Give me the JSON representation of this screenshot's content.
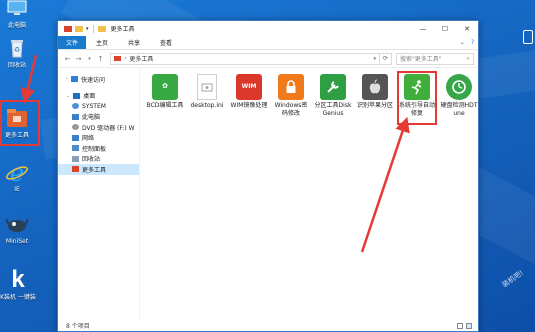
{
  "desktop": {
    "icons": [
      {
        "label": "此电脑",
        "icon": "computer-icon"
      },
      {
        "label": "回收站",
        "icon": "recycle-bin-icon"
      },
      {
        "label": "更多工具",
        "icon": "toolbox-folder-icon"
      },
      {
        "label": "IE",
        "icon": "ie-icon"
      },
      {
        "label": "MiniSet",
        "icon": "miniset-icon"
      },
      {
        "label": "K装机 一键装",
        "icon": "k-logo-icon"
      }
    ],
    "watermark": "装机吧!",
    "right_edge_icon": "network-icon"
  },
  "window": {
    "title": "更多工具",
    "ribbon_tabs": [
      "文件",
      "主页",
      "共享",
      "查看"
    ],
    "address": [
      "更多工具"
    ],
    "search_placeholder": "搜索\"更多工具\"",
    "sidebar": [
      {
        "label": "快速访问",
        "level": 0,
        "color": "#2f7fd6"
      },
      {
        "label": "桌面",
        "level": 0,
        "color": "#1e6fc2"
      },
      {
        "label": "SYSTEM",
        "level": 1,
        "color": "#4a90d9"
      },
      {
        "label": "此电脑",
        "level": 1,
        "color": "#3b7fc4"
      },
      {
        "label": "DVD 驱动器 (F:) W",
        "level": 1,
        "color": "#777777"
      },
      {
        "label": "网络",
        "level": 1,
        "color": "#3b7fc4"
      },
      {
        "label": "控制面板",
        "level": 1,
        "color": "#4f8bc9"
      },
      {
        "label": "回收站",
        "level": 1,
        "color": "#8aa0b8"
      },
      {
        "label": "更多工具",
        "level": 1,
        "color": "#d9442a",
        "selected": true
      }
    ],
    "files": [
      {
        "name": "BCD编辑工具",
        "color": "#38a842",
        "glyph": "✿",
        "icon": "bcd-editor-icon"
      },
      {
        "name": "desktop.ini",
        "color": "#eeeeee",
        "glyph": "",
        "icon": "ini-file-icon"
      },
      {
        "name": "WIM镜像处理",
        "color": "#d9382b",
        "glyph": "WIM",
        "icon": "wim-icon"
      },
      {
        "name": "Windows密码修改",
        "color": "#f07a1a",
        "glyph": "🔒",
        "icon": "password-lock-icon"
      },
      {
        "name": "分区工具DiskGenius",
        "color": "#2ea043",
        "glyph": "🔧",
        "icon": "diskgenius-icon"
      },
      {
        "name": "识别苹果分区",
        "color": "#555555",
        "glyph": "",
        "icon": "apple-icon"
      },
      {
        "name": "系统引导自动修复",
        "color": "#3fae3a",
        "glyph": "🏃",
        "icon": "boot-repair-icon",
        "highlighted": true
      },
      {
        "name": "硬盘检测HDTune",
        "color": "#37a64a",
        "glyph": "⏱",
        "icon": "hdtune-icon"
      }
    ],
    "status": "8 个项目"
  }
}
